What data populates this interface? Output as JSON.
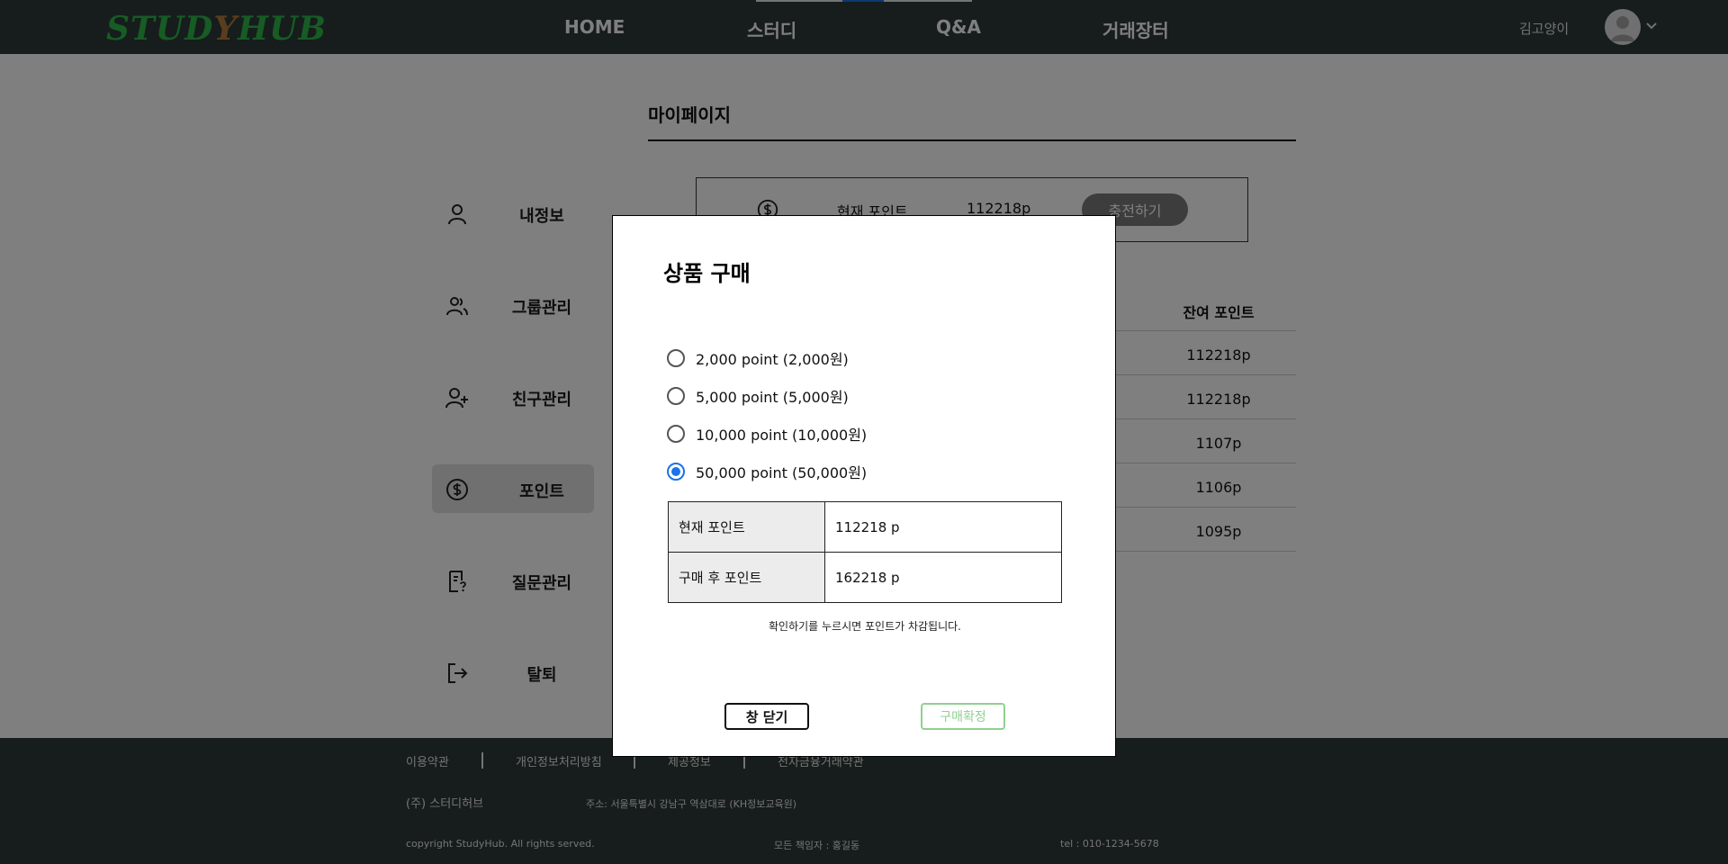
{
  "header": {
    "logo_text": "STUDYHUB",
    "nav": [
      "HOME",
      "스터디",
      "Q&A",
      "거래장터"
    ],
    "username": "김고양이"
  },
  "sidebar": {
    "items": [
      {
        "label": "내정보",
        "icon": "user-icon"
      },
      {
        "label": "그룹관리",
        "icon": "group-icon"
      },
      {
        "label": "친구관리",
        "icon": "add-friend-icon"
      },
      {
        "label": "포인트",
        "icon": "dollar-coin-icon",
        "active": true
      },
      {
        "label": "질문관리",
        "icon": "question-document-icon"
      },
      {
        "label": "탈퇴",
        "icon": "logout-icon"
      }
    ]
  },
  "main": {
    "title": "마이페이지",
    "point_box": {
      "label": "현재 포인트",
      "value": "112218p",
      "charge_label": "충전하기"
    },
    "history": {
      "column_header": "잔여 포인트",
      "rows": [
        "112218p",
        "112218p",
        "1107p",
        "1106p",
        "1095p"
      ]
    }
  },
  "modal": {
    "title": "상품 구매",
    "options": [
      {
        "label": "2,000 point (2,000원)",
        "checked": false
      },
      {
        "label": "5,000 point (5,000원)",
        "checked": false
      },
      {
        "label": "10,000 point (10,000원)",
        "checked": false
      },
      {
        "label": "50,000 point (50,000원)",
        "checked": true
      }
    ],
    "table": [
      {
        "key": "현재 포인트",
        "value": "112218 p"
      },
      {
        "key": "구매 후 포인트",
        "value": "162218 p"
      }
    ],
    "notice": "확인하기를 누르시면 포인트가 차감됩니다.",
    "close_label": "창 닫기",
    "confirm_label": "구매확정"
  },
  "footer": {
    "links": [
      "이용약관",
      "개인정보처리방침",
      "제공정보",
      "전자금융거래약관"
    ],
    "company": "(주) 스터디허브",
    "address": "주소: 서울특별시 강남구 역삼대로 (KH정보교육원)",
    "copyright": "copyright StudyHub. All rights served.",
    "manager": "모든 책임자 : 홍길동",
    "tel": "tel : 010-1234-5678"
  },
  "colors": {
    "header_bg": "#2d3b38",
    "logo_green": "#2fb64a",
    "accent_blue": "#1a73e8",
    "confirm_green": "#8fd18f"
  }
}
